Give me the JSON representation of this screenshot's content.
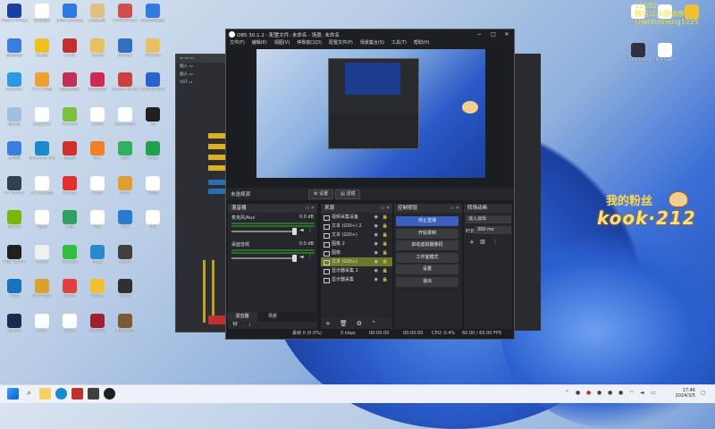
{
  "overlay": {
    "line1": "11582",
    "line2": "微信公众號请群",
    "line3": "chenfusheng1125"
  },
  "brand": {
    "line1": "我的粉丝",
    "line2": "kook·212"
  },
  "desktop_icons": [
    {
      "label": "Adobe Photoshop",
      "color": "#1a3fa0",
      "col": 0,
      "row": 0
    },
    {
      "label": "微信截图",
      "color": "#ffffff",
      "col": 1,
      "row": 0
    },
    {
      "label": "Jump Desktop",
      "color": "#2d7be0",
      "col": 2,
      "row": 0
    },
    {
      "label": "腾讯课堂",
      "color": "#e0c080",
      "col": 3,
      "row": 0
    },
    {
      "label": "MYREDcopy",
      "color": "#d05050",
      "col": 4,
      "row": 0
    },
    {
      "label": "网易有道翻译",
      "color": "#2f7be0",
      "col": 5,
      "row": 0
    },
    {
      "label": "控制面板",
      "color": "#3c7de0",
      "col": 0,
      "row": 1
    },
    {
      "label": "爱发现",
      "color": "#f0c020",
      "col": 1,
      "row": 1
    },
    {
      "label": "Circle",
      "color": "#c03030",
      "col": 2,
      "row": 1
    },
    {
      "label": "文件夹",
      "color": "#e8c060",
      "col": 3,
      "row": 1
    },
    {
      "label": "ShareX",
      "color": "#3070c0",
      "col": 4,
      "row": 1
    },
    {
      "label": "WeChat",
      "color": "#e8c060",
      "col": 5,
      "row": 1
    },
    {
      "label": "Network",
      "color": "#2a9be0",
      "col": 0,
      "row": 2
    },
    {
      "label": "千牛工作台",
      "color": "#f0a030",
      "col": 1,
      "row": 2
    },
    {
      "label": "网易云音乐",
      "color": "#c0305a",
      "col": 2,
      "row": 2
    },
    {
      "label": "Potplayer",
      "color": "#d02a50",
      "col": 3,
      "row": 2
    },
    {
      "label": "Screen Recorder",
      "color": "#cc4040",
      "col": 4,
      "row": 2
    },
    {
      "label": "SUSPICIOUS",
      "color": "#2a60d0",
      "col": 5,
      "row": 2
    },
    {
      "label": "回收站",
      "color": "#a0c0e0",
      "col": 0,
      "row": 3
    },
    {
      "label": "文档2022",
      "color": "#ffffff",
      "col": 1,
      "row": 3
    },
    {
      "label": "Android",
      "color": "#7cc040",
      "col": 2,
      "row": 3
    },
    {
      "label": "Baidu",
      "color": "#ffffff",
      "col": 3,
      "row": 3
    },
    {
      "label": "Document",
      "color": "#ffffff",
      "col": 4,
      "row": 3
    },
    {
      "label": "kk",
      "color": "#202020",
      "col": 5,
      "row": 3
    },
    {
      "label": "此电脑",
      "color": "#3c7de0",
      "col": 0,
      "row": 4
    },
    {
      "label": "Microsoft Edge",
      "color": "#1a8ad0",
      "col": 1,
      "row": 4
    },
    {
      "label": "网易云",
      "color": "#d03030",
      "col": 2,
      "row": 4
    },
    {
      "label": "VLC",
      "color": "#f08020",
      "col": 3,
      "row": 4
    },
    {
      "label": "剪辑",
      "color": "#30b060",
      "col": 4,
      "row": 4
    },
    {
      "label": "KOOK",
      "color": "#20a050",
      "col": 5,
      "row": 4
    },
    {
      "label": "Mi Theme",
      "color": "#304050",
      "col": 0,
      "row": 5
    },
    {
      "label": "Mi Desktop",
      "color": "#ffffff",
      "col": 1,
      "row": 5
    },
    {
      "label": "Rocket",
      "color": "#e03030",
      "col": 2,
      "row": 5
    },
    {
      "label": "Eagle",
      "color": "#ffffff",
      "col": 3,
      "row": 5
    },
    {
      "label": "Xbox",
      "color": "#e0a030",
      "col": 4,
      "row": 5
    },
    {
      "label": "Pirate",
      "color": "#ffffff",
      "col": 5,
      "row": 5
    },
    {
      "label": "NVIDIA",
      "color": "#76b900",
      "col": 0,
      "row": 6
    },
    {
      "label": "Word",
      "color": "#ffffff",
      "col": 1,
      "row": 6
    },
    {
      "label": "Clip",
      "color": "#30a060",
      "col": 2,
      "row": 6
    },
    {
      "label": "Play",
      "color": "#ffffff",
      "col": 3,
      "row": 6
    },
    {
      "label": "GTA",
      "color": "#2a7ad0",
      "col": 4,
      "row": 6
    },
    {
      "label": "QQ",
      "color": "#ffffff",
      "col": 5,
      "row": 6
    },
    {
      "label": "OBS Studio",
      "color": "#202020",
      "col": 0,
      "row": 7
    },
    {
      "label": "Notes",
      "color": "#f0f0f0",
      "col": 1,
      "row": 7
    },
    {
      "label": "WeChat",
      "color": "#30c040",
      "col": 2,
      "row": 7
    },
    {
      "label": "Maps",
      "color": "#2a8ad0",
      "col": 3,
      "row": 7
    },
    {
      "label": "Cloud",
      "color": "#404040",
      "col": 4,
      "row": 7
    },
    {
      "label": "Chat",
      "color": "#1a70c0",
      "col": 0,
      "row": 8
    },
    {
      "label": "QQ Music",
      "color": "#e0a030",
      "col": 1,
      "row": 8
    },
    {
      "label": "Game",
      "color": "#e04040",
      "col": 2,
      "row": 8
    },
    {
      "label": "Folder",
      "color": "#f0c030",
      "col": 3,
      "row": 8
    },
    {
      "label": "Video",
      "color": "#303030",
      "col": 4,
      "row": 8
    },
    {
      "label": "Steam",
      "color": "#1a2a50",
      "col": 0,
      "row": 9
    },
    {
      "label": "Lock",
      "color": "#ffffff",
      "col": 1,
      "row": 9
    },
    {
      "label": "Player",
      "color": "#ffffff",
      "col": 2,
      "row": 9
    },
    {
      "label": "WinRAR",
      "color": "#a02030",
      "col": 3,
      "row": 9
    },
    {
      "label": "Minecraft",
      "color": "#7a5a30",
      "col": 4,
      "row": 9
    }
  ],
  "right_icons": [
    {
      "label": "Jul 1st",
      "color": "#ffffff"
    },
    {
      "label": "Sheet",
      "color": "#ffffff"
    },
    {
      "label": "Folder",
      "color": "#f0c030"
    },
    {
      "label": "Global Gateway",
      "color": "#303040"
    },
    {
      "label": "MicroSoft",
      "color": "#ffffff"
    }
  ],
  "obs": {
    "title": "OBS 30.1.2 - 配置文件: 未命名 - 场景: 未命名",
    "menu": [
      "文件(F)",
      "编辑(E)",
      "视图(V)",
      "停靠窗口(D)",
      "配置文件(P)",
      "场景集合(S)",
      "工具(T)",
      "帮助(H)"
    ],
    "no_source": "未选择源",
    "settings_btn": "设置",
    "filter_btn": "滤镜",
    "mixer": {
      "title": "混音器",
      "channels": [
        {
          "name": "麦克风/Aux",
          "db": "0.0 dB"
        },
        {
          "name": "桌面音频",
          "db": "0.0 dB"
        }
      ]
    },
    "sources": {
      "title": "来源",
      "items": [
        {
          "name": "视频采集设备",
          "selected": false
        },
        {
          "name": "文本 (GDI+) 2",
          "selected": false
        },
        {
          "name": "文本 (GDI+)",
          "selected": false
        },
        {
          "name": "图像 2",
          "selected": false
        },
        {
          "name": "图像",
          "selected": false
        },
        {
          "name": "文本 (GDI+)",
          "selected": true
        },
        {
          "name": "显示器采集 2",
          "selected": false
        },
        {
          "name": "显示器采集",
          "selected": false
        }
      ]
    },
    "controls": {
      "title": "控制按钮",
      "buttons": [
        "停止直播",
        "开始录制",
        "启动虚拟摄像机",
        "工作室模式",
        "设置",
        "退出"
      ]
    },
    "transitions": {
      "title": "转场动画",
      "type": "淡入淡出",
      "duration_label": "时长",
      "duration": "300 ms"
    },
    "tabs": [
      "混音器",
      "场景"
    ],
    "status": {
      "frames": "丢帧 0 (0.0%)",
      "kbps": "0 kbps",
      "time1": "00:00:00",
      "time2": "00:00:00",
      "cpu": "CPU: 0.4%",
      "fps": "60.00 / 60.00 FPS"
    }
  },
  "taskbar": {
    "time": "17:46",
    "date": "2024/3/5"
  }
}
